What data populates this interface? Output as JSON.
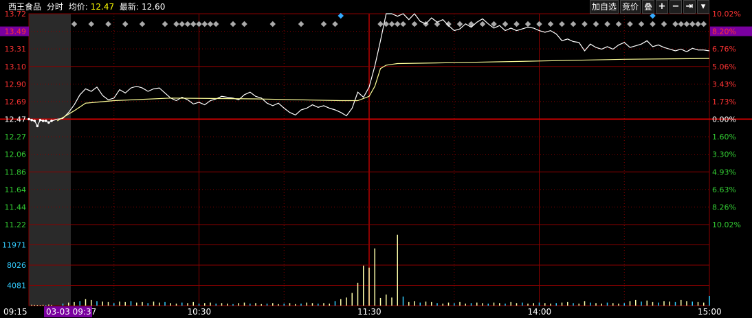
{
  "header": {
    "stock_name": "西王食品",
    "mode_label": "分时",
    "avg_label": "均价:",
    "avg_value": "12.47",
    "last_label": "最新:",
    "last_value": "12.60"
  },
  "toolbar": {
    "add_watch": "加自选",
    "auction": "竞价",
    "overlay": "叠",
    "plus": "+",
    "minus": "−",
    "jump": "⇥",
    "dropdown": "▾"
  },
  "time_labels": {
    "open_auction": "09:15",
    "date_time": "03-03 09:37",
    "t1030": "10:30",
    "t1130": "11:30",
    "t1400": "14:00",
    "t1500": "15:00"
  },
  "chart_data": {
    "type": "line",
    "prev_close": 12.47,
    "y_price_ticks": [
      "13.72",
      "13.49",
      "13.31",
      "13.10",
      "12.90",
      "12.69",
      "12.47",
      "12.27",
      "12.06",
      "11.86",
      "11.64",
      "11.44",
      "11.22"
    ],
    "y_pct_ticks": [
      "10.02%",
      "8.20%",
      "6.76%",
      "5.06%",
      "3.43%",
      "1.73%",
      "0.00%",
      "1.60%",
      "3.30%",
      "4.93%",
      "6.63%",
      "8.26%",
      "10.02%"
    ],
    "volume_ticks": [
      "11971",
      "8026",
      "4081"
    ],
    "ylim": [
      11.22,
      13.72
    ],
    "highlighted_price": "13.49",
    "highlighted_pct": "8.20%",
    "colors": {
      "price_line": "#ffffff",
      "avg_line": "#ffff99",
      "up_text": "#ff3333",
      "down_text": "#33cc33",
      "grid": "#8b0000",
      "prev_close_line": "#cc0000",
      "volume_axis": "#33ccff",
      "highlight_bg": "#7a00a0"
    },
    "series": [
      {
        "role": "price",
        "points": [
          [
            0,
            12.47
          ],
          [
            0.5,
            12.46
          ],
          [
            1,
            12.45
          ],
          [
            1.5,
            12.39
          ],
          [
            2,
            12.46
          ],
          [
            2.5,
            12.45
          ],
          [
            3,
            12.45
          ],
          [
            3.5,
            12.43
          ],
          [
            4,
            12.45
          ],
          [
            5,
            12.47
          ],
          [
            6,
            12.48
          ],
          [
            7,
            12.55
          ],
          [
            8,
            12.64
          ],
          [
            9,
            12.76
          ],
          [
            10,
            12.83
          ],
          [
            11,
            12.8
          ],
          [
            12,
            12.85
          ],
          [
            13,
            12.75
          ],
          [
            14,
            12.7
          ],
          [
            15,
            12.72
          ],
          [
            16,
            12.82
          ],
          [
            17,
            12.78
          ],
          [
            18,
            12.84
          ],
          [
            19,
            12.86
          ],
          [
            20,
            12.84
          ],
          [
            21,
            12.8
          ],
          [
            22,
            12.83
          ],
          [
            23,
            12.84
          ],
          [
            24,
            12.78
          ],
          [
            25,
            12.72
          ],
          [
            26,
            12.69
          ],
          [
            27,
            12.73
          ],
          [
            28,
            12.7
          ],
          [
            29,
            12.65
          ],
          [
            30,
            12.67
          ],
          [
            31,
            12.64
          ],
          [
            32,
            12.69
          ],
          [
            33,
            12.71
          ],
          [
            34,
            12.74
          ],
          [
            35,
            12.73
          ],
          [
            36,
            12.72
          ],
          [
            37,
            12.7
          ],
          [
            38,
            12.76
          ],
          [
            39,
            12.79
          ],
          [
            40,
            12.74
          ],
          [
            41,
            12.72
          ],
          [
            42,
            12.66
          ],
          [
            43,
            12.63
          ],
          [
            44,
            12.66
          ],
          [
            45,
            12.6
          ],
          [
            46,
            12.55
          ],
          [
            47,
            12.52
          ],
          [
            48,
            12.58
          ],
          [
            49,
            12.6
          ],
          [
            50,
            12.64
          ],
          [
            51,
            12.61
          ],
          [
            52,
            12.63
          ],
          [
            53,
            12.6
          ],
          [
            54,
            12.58
          ],
          [
            55,
            12.55
          ],
          [
            56,
            12.51
          ],
          [
            57,
            12.6
          ],
          [
            58,
            12.79
          ],
          [
            59,
            12.73
          ],
          [
            60,
            12.85
          ],
          [
            61,
            13.1
          ],
          [
            62,
            13.4
          ],
          [
            63,
            13.72
          ],
          [
            64,
            13.72
          ],
          [
            65,
            13.69
          ],
          [
            66,
            13.72
          ],
          [
            67,
            13.65
          ],
          [
            68,
            13.72
          ],
          [
            69,
            13.63
          ],
          [
            70,
            13.6
          ],
          [
            71,
            13.67
          ],
          [
            72,
            13.62
          ],
          [
            73,
            13.65
          ],
          [
            74,
            13.58
          ],
          [
            75,
            13.52
          ],
          [
            76,
            13.54
          ],
          [
            77,
            13.6
          ],
          [
            78,
            13.56
          ],
          [
            79,
            13.62
          ],
          [
            80,
            13.66
          ],
          [
            81,
            13.6
          ],
          [
            82,
            13.55
          ],
          [
            83,
            13.58
          ],
          [
            84,
            13.52
          ],
          [
            85,
            13.55
          ],
          [
            86,
            13.52
          ],
          [
            87,
            13.54
          ],
          [
            88,
            13.56
          ],
          [
            89,
            13.55
          ],
          [
            90,
            13.52
          ],
          [
            91,
            13.5
          ],
          [
            92,
            13.52
          ],
          [
            93,
            13.48
          ],
          [
            94,
            13.4
          ],
          [
            95,
            13.42
          ],
          [
            96,
            13.39
          ],
          [
            97,
            13.38
          ],
          [
            98,
            13.28
          ],
          [
            99,
            13.36
          ],
          [
            100,
            13.32
          ],
          [
            101,
            13.3
          ],
          [
            102,
            13.33
          ],
          [
            103,
            13.3
          ],
          [
            104,
            13.35
          ],
          [
            105,
            13.38
          ],
          [
            106,
            13.32
          ],
          [
            107,
            13.34
          ],
          [
            108,
            13.36
          ],
          [
            109,
            13.4
          ],
          [
            110,
            13.33
          ],
          [
            111,
            13.35
          ],
          [
            112,
            13.32
          ],
          [
            113,
            13.3
          ],
          [
            114,
            13.28
          ],
          [
            115,
            13.3
          ],
          [
            116,
            13.27
          ],
          [
            117,
            13.31
          ],
          [
            118,
            13.29
          ],
          [
            119,
            13.29
          ],
          [
            120,
            13.28
          ]
        ]
      },
      {
        "role": "average",
        "points": [
          [
            5,
            12.45
          ],
          [
            8,
            12.57
          ],
          [
            10,
            12.66
          ],
          [
            15,
            12.69
          ],
          [
            25,
            12.72
          ],
          [
            40,
            12.71
          ],
          [
            55,
            12.69
          ],
          [
            58,
            12.69
          ],
          [
            60,
            12.74
          ],
          [
            61,
            12.86
          ],
          [
            62,
            13.07
          ],
          [
            63,
            13.11
          ],
          [
            64,
            13.12
          ],
          [
            65,
            13.13
          ],
          [
            75,
            13.14
          ],
          [
            90,
            13.16
          ],
          [
            105,
            13.18
          ],
          [
            120,
            13.19
          ]
        ]
      }
    ],
    "volume_bars": [
      [
        0.5,
        180
      ],
      [
        1,
        150
      ],
      [
        1.5,
        140
      ],
      [
        2,
        120
      ],
      [
        2.5,
        160
      ],
      [
        3,
        140
      ],
      [
        3.5,
        200
      ],
      [
        4,
        150
      ],
      [
        6,
        400
      ],
      [
        7,
        600
      ],
      [
        8,
        700
      ],
      [
        9,
        900
      ],
      [
        10,
        1300
      ],
      [
        11,
        1100
      ],
      [
        12,
        900
      ],
      [
        13,
        800
      ],
      [
        14,
        700
      ],
      [
        15,
        500
      ],
      [
        16,
        800
      ],
      [
        17,
        700
      ],
      [
        18,
        900
      ],
      [
        19,
        600
      ],
      [
        20,
        700
      ],
      [
        21,
        500
      ],
      [
        22,
        800
      ],
      [
        23,
        600
      ],
      [
        24,
        700
      ],
      [
        25,
        500
      ],
      [
        26,
        400
      ],
      [
        27,
        600
      ],
      [
        28,
        500
      ],
      [
        29,
        700
      ],
      [
        30,
        400
      ],
      [
        31,
        500
      ],
      [
        32,
        600
      ],
      [
        33,
        400
      ],
      [
        34,
        500
      ],
      [
        35,
        400
      ],
      [
        36,
        300
      ],
      [
        37,
        500
      ],
      [
        38,
        600
      ],
      [
        39,
        400
      ],
      [
        40,
        500
      ],
      [
        41,
        300
      ],
      [
        42,
        400
      ],
      [
        43,
        500
      ],
      [
        44,
        300
      ],
      [
        45,
        400
      ],
      [
        46,
        500
      ],
      [
        47,
        300
      ],
      [
        48,
        400
      ],
      [
        49,
        600
      ],
      [
        50,
        500
      ],
      [
        51,
        400
      ],
      [
        52,
        500
      ],
      [
        53,
        400
      ],
      [
        54,
        900
      ],
      [
        55,
        1300
      ],
      [
        56,
        1600
      ],
      [
        57,
        2500
      ],
      [
        58,
        4500
      ],
      [
        59,
        7900
      ],
      [
        60,
        7500
      ],
      [
        61,
        11300
      ],
      [
        62,
        1500
      ],
      [
        63,
        2200
      ],
      [
        64,
        1600
      ],
      [
        65,
        14000
      ],
      [
        66,
        1800
      ],
      [
        67,
        700
      ],
      [
        68,
        900
      ],
      [
        69,
        600
      ],
      [
        70,
        800
      ],
      [
        71,
        700
      ],
      [
        72,
        500
      ],
      [
        73,
        400
      ],
      [
        74,
        600
      ],
      [
        75,
        500
      ],
      [
        76,
        700
      ],
      [
        77,
        400
      ],
      [
        78,
        500
      ],
      [
        79,
        600
      ],
      [
        80,
        500
      ],
      [
        81,
        400
      ],
      [
        82,
        600
      ],
      [
        83,
        500
      ],
      [
        84,
        400
      ],
      [
        85,
        700
      ],
      [
        86,
        500
      ],
      [
        87,
        600
      ],
      [
        88,
        400
      ],
      [
        89,
        500
      ],
      [
        90,
        600
      ],
      [
        91,
        500
      ],
      [
        92,
        400
      ],
      [
        93,
        500
      ],
      [
        94,
        600
      ],
      [
        95,
        700
      ],
      [
        96,
        500
      ],
      [
        97,
        400
      ],
      [
        98,
        900
      ],
      [
        99,
        600
      ],
      [
        100,
        500
      ],
      [
        101,
        400
      ],
      [
        102,
        600
      ],
      [
        103,
        500
      ],
      [
        104,
        400
      ],
      [
        105,
        500
      ],
      [
        106,
        900
      ],
      [
        107,
        1100
      ],
      [
        108,
        800
      ],
      [
        109,
        1000
      ],
      [
        110,
        700
      ],
      [
        111,
        600
      ],
      [
        112,
        900
      ],
      [
        113,
        800
      ],
      [
        114,
        700
      ],
      [
        115,
        1100
      ],
      [
        116,
        900
      ],
      [
        117,
        800
      ],
      [
        118,
        700
      ],
      [
        119,
        600
      ],
      [
        120,
        1900
      ]
    ],
    "markers": {
      "gray": [
        8,
        11,
        14,
        17,
        20,
        24,
        26,
        27,
        28,
        29,
        30,
        31,
        32,
        33,
        36,
        38,
        43,
        48,
        52,
        54,
        62,
        63,
        64,
        65,
        66,
        68,
        70,
        72,
        74,
        76,
        78,
        80,
        82,
        84,
        86,
        88,
        90,
        92,
        94,
        96,
        98,
        100,
        102,
        104,
        106,
        108,
        110,
        112,
        114,
        115,
        116,
        117,
        118,
        119
      ],
      "blue": [
        55,
        110
      ]
    }
  }
}
